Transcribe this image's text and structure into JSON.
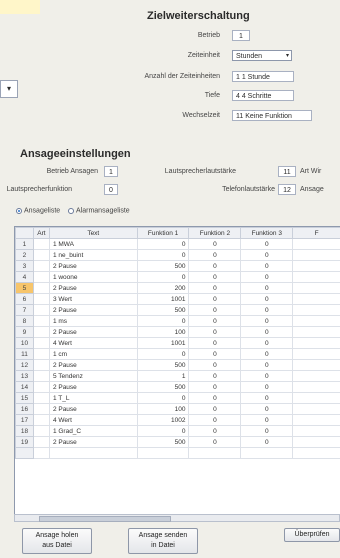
{
  "ziel": {
    "title": "Zielweiterschaltung",
    "betrieb_label": "Betrieb",
    "betrieb_value": "1",
    "zeiteinheit_label": "Zeiteinheit",
    "zeiteinheit_value": "Stunden",
    "anzahl_label": "Anzahl der Zeiteinheiten",
    "anzahl_value": "1 1 Stunde",
    "tiefe_label": "Tiefe",
    "tiefe_value": "4 4 Schritte",
    "wechselzeit_label": "Wechselzeit",
    "wechselzeit_value": "11 Keine Funktion"
  },
  "ansage": {
    "title": "Ansageeinstellungen",
    "betrieb_label": "Betrieb Ansagen",
    "betrieb_value": "1",
    "lautspr_label": "Lautsprecherlautstärke",
    "lautspr_value": "11",
    "art_label": "Art Wir",
    "lautfunk_label": "Lautsprecherfunktion",
    "lautfunk_value": "0",
    "tel_label": "Telefonlautstärke",
    "tel_value": "12",
    "ansage_label": "Ansage",
    "radio1": "Ansageliste",
    "radio2": "Alarmansageliste"
  },
  "grid": {
    "columns": [
      "Art",
      "Text",
      "Funktion 1",
      "Funktion 2",
      "Funktion 3",
      "F"
    ],
    "rows": [
      {
        "n": "1",
        "art": "",
        "text": "1 MWA",
        "f1": "0",
        "f2": "0",
        "f3": "0"
      },
      {
        "n": "2",
        "art": "",
        "text": "1 ne_buint",
        "f1": "0",
        "f2": "0",
        "f3": "0"
      },
      {
        "n": "3",
        "art": "",
        "text": "2 Pause",
        "f1": "500",
        "f2": "0",
        "f3": "0"
      },
      {
        "n": "4",
        "art": "",
        "text": "1 woone",
        "f1": "0",
        "f2": "0",
        "f3": "0"
      },
      {
        "n": "5",
        "art": "",
        "text": "2 Pause",
        "f1": "200",
        "f2": "0",
        "f3": "0"
      },
      {
        "n": "6",
        "art": "",
        "text": "3 Wert",
        "f1": "1001",
        "f2": "0",
        "f3": "0"
      },
      {
        "n": "7",
        "art": "",
        "text": "2 Pause",
        "f1": "500",
        "f2": "0",
        "f3": "0"
      },
      {
        "n": "8",
        "art": "",
        "text": "1 ms",
        "f1": "0",
        "f2": "0",
        "f3": "0"
      },
      {
        "n": "9",
        "art": "",
        "text": "2 Pause",
        "f1": "100",
        "f2": "0",
        "f3": "0"
      },
      {
        "n": "10",
        "art": "",
        "text": "4 Wert",
        "f1": "1001",
        "f2": "0",
        "f3": "0"
      },
      {
        "n": "11",
        "art": "",
        "text": "1 cm",
        "f1": "0",
        "f2": "0",
        "f3": "0"
      },
      {
        "n": "12",
        "art": "",
        "text": "2 Pause",
        "f1": "500",
        "f2": "0",
        "f3": "0"
      },
      {
        "n": "13",
        "art": "",
        "text": "5 Tendenz",
        "f1": "1",
        "f2": "0",
        "f3": "0"
      },
      {
        "n": "14",
        "art": "",
        "text": "2 Pause",
        "f1": "500",
        "f2": "0",
        "f3": "0"
      },
      {
        "n": "15",
        "art": "",
        "text": "1 T_L",
        "f1": "0",
        "f2": "0",
        "f3": "0"
      },
      {
        "n": "16",
        "art": "",
        "text": "2 Pause",
        "f1": "100",
        "f2": "0",
        "f3": "0"
      },
      {
        "n": "17",
        "art": "",
        "text": "4 Wert",
        "f1": "1002",
        "f2": "0",
        "f3": "0"
      },
      {
        "n": "18",
        "art": "",
        "text": "1 Grad_C",
        "f1": "0",
        "f2": "0",
        "f3": "0"
      },
      {
        "n": "19",
        "art": "",
        "text": "2 Pause",
        "f1": "500",
        "f2": "0",
        "f3": "0"
      },
      {
        "n": "",
        "art": "",
        "text": "",
        "f1": "",
        "f2": "",
        "f3": ""
      }
    ],
    "selected_row": 4
  },
  "buttons": {
    "holen_l1": "Ansage holen",
    "holen_l2": "aus Datei",
    "senden_l1": "Ansage senden",
    "senden_l2": "in Datei",
    "pruef": "Überprüfen"
  },
  "colors": {
    "selected_row_header": "#f7c56b",
    "highlight_strip": "#fff6c9"
  },
  "icons": {
    "dropdown": "chevron-down-icon"
  }
}
